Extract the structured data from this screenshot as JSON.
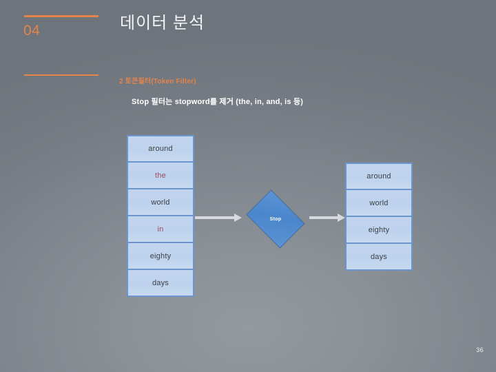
{
  "slide": {
    "number_label": "04",
    "title": "데이터 분석",
    "section_title": "2  토큰필터(Token Filter)",
    "body_text": "Stop 필터는 stopword를 제거 (the, in, and, is 등)",
    "page_number": "36",
    "accent_color": "#e8834a",
    "background_color": "#80868d",
    "title_color": "#f2f4f6"
  },
  "diagram": {
    "box_fill_color": "#c2d5ee",
    "box_border_color": "#6b95cd",
    "box_text_color": "#3c4146",
    "stopword_text_color": "#a04a5e",
    "diamond_fill_color": "#4b86cc",
    "diamond_border_color": "#2e5c96",
    "diamond_label_color": "#ffffff",
    "arrow_color": "#d6dadd",
    "input_tokens": [
      {
        "label": "around",
        "is_stopword": false
      },
      {
        "label": "the",
        "is_stopword": true
      },
      {
        "label": "world",
        "is_stopword": false
      },
      {
        "label": "in",
        "is_stopword": true
      },
      {
        "label": "eighty",
        "is_stopword": false
      },
      {
        "label": "days",
        "is_stopword": false
      }
    ],
    "filter": {
      "label": "Stop"
    },
    "output_tokens": [
      {
        "label": "around",
        "is_stopword": false
      },
      {
        "label": "world",
        "is_stopword": false
      },
      {
        "label": "eighty",
        "is_stopword": false
      },
      {
        "label": "days",
        "is_stopword": false
      }
    ]
  }
}
